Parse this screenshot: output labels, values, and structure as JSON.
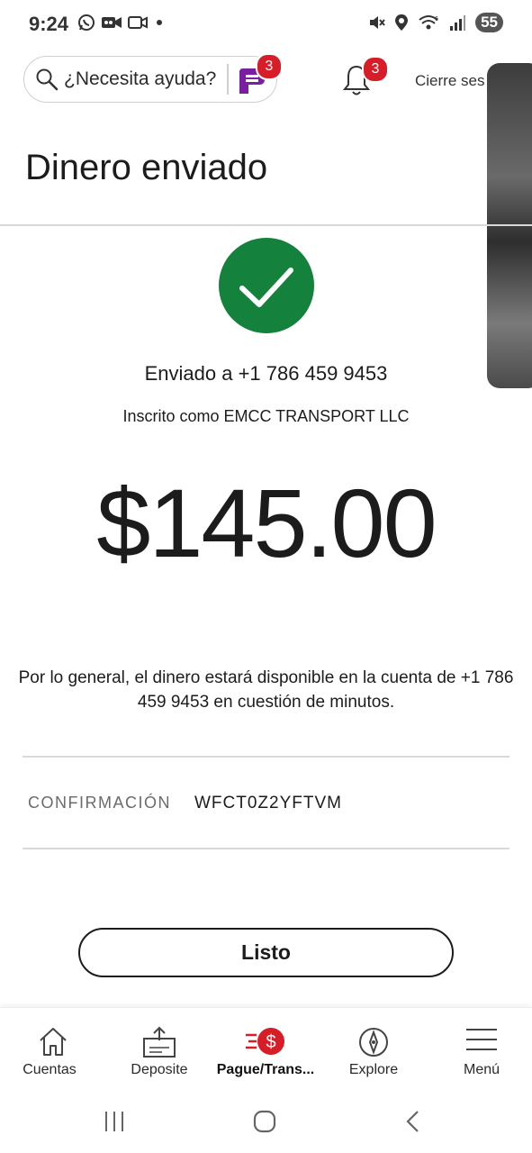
{
  "status_bar": {
    "time": "9:24",
    "battery": "55",
    "left_icons": [
      "whatsapp-icon",
      "video-call-icon",
      "camera-icon",
      "dot-icon"
    ],
    "right_icons": [
      "mute-icon",
      "location-icon",
      "wifi-icon",
      "signal-icon"
    ]
  },
  "header": {
    "search_placeholder": "¿Necesita ayuda?",
    "assistant_badge": "3",
    "notifications_badge": "3",
    "sign_off_label": "Cierre ses"
  },
  "page": {
    "title": "Dinero enviado"
  },
  "receipt": {
    "sent_to": "Enviado a +1 786 459 9453",
    "enrolled_as": "Inscrito como EMCC TRANSPORT LLC",
    "amount": "$145.00",
    "availability_note": "Por lo general, el dinero estará disponible en la cuenta de +1 786 459 9453 en cuestión de minutos.",
    "confirmation_label": "CONFIRMACIÓN",
    "confirmation_code": "WFCT0Z2YFTVM",
    "done_label": "Listo"
  },
  "bottom_nav": {
    "items": [
      {
        "label": "Cuentas",
        "icon": "home-icon"
      },
      {
        "label": "Deposite",
        "icon": "deposit-icon"
      },
      {
        "label": "Pague/Trans...",
        "icon": "pay-transfer-icon",
        "active": true
      },
      {
        "label": "Explore",
        "icon": "compass-icon"
      },
      {
        "label": "Menú",
        "icon": "hamburger-menu-icon"
      }
    ]
  },
  "colors": {
    "brand_red": "#d71e28",
    "success_green": "#14823c",
    "assistant_purple": "#7b1fa2"
  }
}
